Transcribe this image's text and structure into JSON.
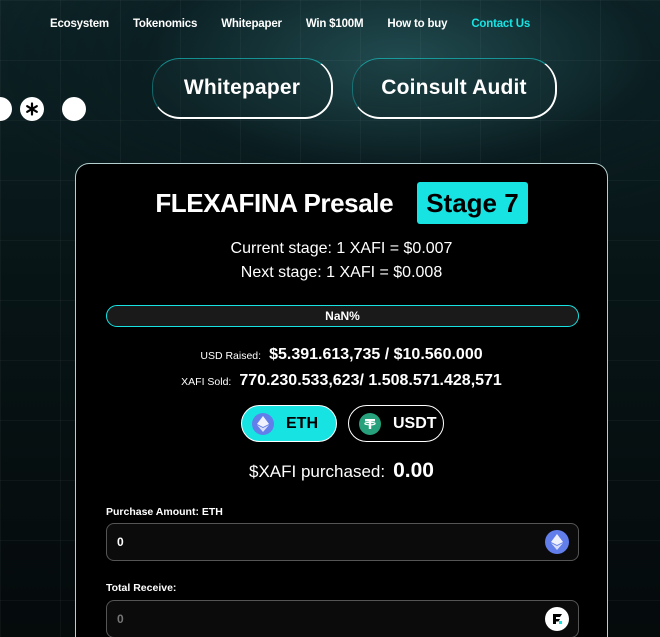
{
  "nav": {
    "items": [
      {
        "label": "Ecosystem"
      },
      {
        "label": "Tokenomics"
      },
      {
        "label": "Whitepaper"
      },
      {
        "label": "Win $100M"
      },
      {
        "label": "How to buy"
      },
      {
        "label": "Contact Us"
      }
    ],
    "active_index": 5
  },
  "top_buttons": {
    "whitepaper": "Whitepaper",
    "audit": "Coinsult Audit"
  },
  "social": {
    "icons": [
      "linktree-icon",
      "social-icon"
    ]
  },
  "presale": {
    "title": "FLEXAFINA Presale",
    "stage": "Stage 7",
    "current_stage": "Current stage: 1 XAFI = $0.007",
    "next_stage": "Next stage: 1 XAFI = $0.008",
    "progress_text": "NaN%",
    "usd_raised_label": "USD Raised:",
    "usd_raised_value": "$5.391.613,735 / $10.560.000",
    "xafi_sold_label": "XAFI Sold:",
    "xafi_sold_value": "770.230.533,623/ 1.508.571.428,571",
    "currencies": {
      "eth": "ETH",
      "usdt": "USDT",
      "selected": "ETH"
    },
    "purchased_label": "$XAFI purchased:",
    "purchased_value": "0.00",
    "purchase_amount_label": "Purchase Amount: ETH",
    "purchase_amount_value": "0",
    "total_receive_label": "Total Receive:",
    "total_receive_placeholder": "0"
  },
  "colors": {
    "accent": "#18e3e3",
    "eth": "#627eea",
    "usdt": "#26a17b",
    "card_bg": "#000000"
  }
}
